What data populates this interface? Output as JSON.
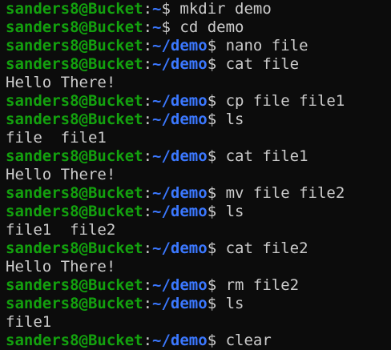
{
  "terminal": {
    "colors": {
      "background": "#0c0c0c",
      "foreground": "#cccccc",
      "user_host": "#13a10e",
      "path": "#3b78ff"
    },
    "lines": [
      {
        "type": "prompt",
        "user_host": "sanders8@Bucket",
        "path": "~",
        "command": "mkdir demo"
      },
      {
        "type": "prompt",
        "user_host": "sanders8@Bucket",
        "path": "~",
        "command": "cd demo"
      },
      {
        "type": "prompt",
        "user_host": "sanders8@Bucket",
        "path": "~/demo",
        "command": "nano file"
      },
      {
        "type": "prompt",
        "user_host": "sanders8@Bucket",
        "path": "~/demo",
        "command": "cat file"
      },
      {
        "type": "output",
        "text": "Hello There!"
      },
      {
        "type": "prompt",
        "user_host": "sanders8@Bucket",
        "path": "~/demo",
        "command": "cp file file1"
      },
      {
        "type": "prompt",
        "user_host": "sanders8@Bucket",
        "path": "~/demo",
        "command": "ls"
      },
      {
        "type": "output",
        "text": "file  file1"
      },
      {
        "type": "prompt",
        "user_host": "sanders8@Bucket",
        "path": "~/demo",
        "command": "cat file1"
      },
      {
        "type": "output",
        "text": "Hello There!"
      },
      {
        "type": "prompt",
        "user_host": "sanders8@Bucket",
        "path": "~/demo",
        "command": "mv file file2"
      },
      {
        "type": "prompt",
        "user_host": "sanders8@Bucket",
        "path": "~/demo",
        "command": "ls"
      },
      {
        "type": "output",
        "text": "file1  file2"
      },
      {
        "type": "prompt",
        "user_host": "sanders8@Bucket",
        "path": "~/demo",
        "command": "cat file2"
      },
      {
        "type": "output",
        "text": "Hello There!"
      },
      {
        "type": "prompt",
        "user_host": "sanders8@Bucket",
        "path": "~/demo",
        "command": "rm file2"
      },
      {
        "type": "prompt",
        "user_host": "sanders8@Bucket",
        "path": "~/demo",
        "command": "ls"
      },
      {
        "type": "output",
        "text": "file1"
      },
      {
        "type": "prompt",
        "user_host": "sanders8@Bucket",
        "path": "~/demo",
        "command": "clear"
      }
    ]
  }
}
